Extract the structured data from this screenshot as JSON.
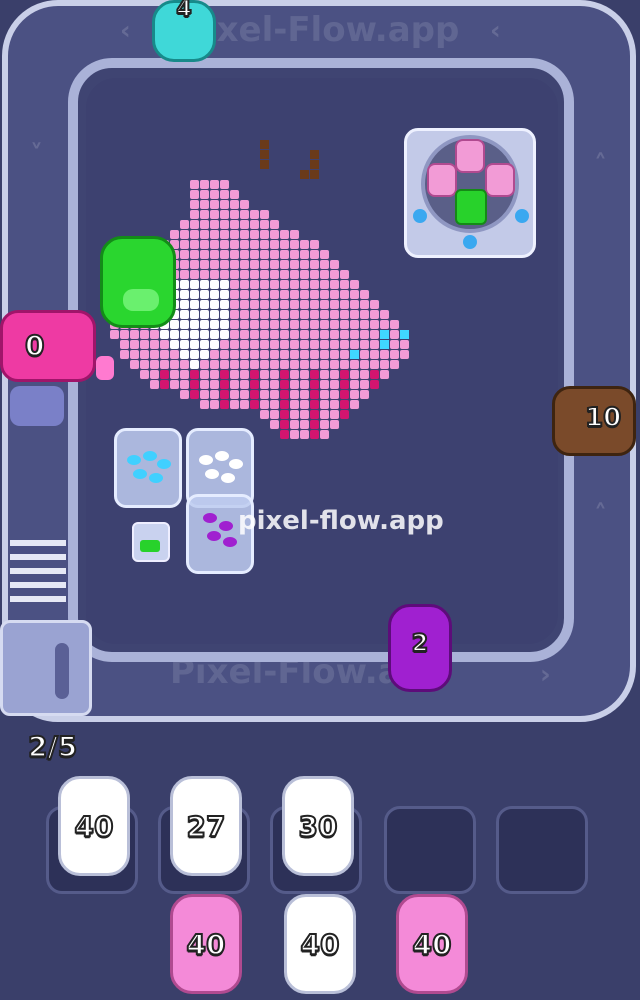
{
  "track": {
    "label": "Pixel-Flow.app",
    "accent_color": "#aab2d8"
  },
  "watermark": "pixel-flow.app",
  "capacity": {
    "label": "2/5",
    "current": 2,
    "max": 5
  },
  "conveyor_shooters": [
    {
      "count": "4",
      "color": "#3fd8d8"
    },
    {
      "count": "0",
      "color": "#ee3aa3"
    },
    {
      "count": "10",
      "color": "#7a4a2a"
    },
    {
      "count": "2",
      "color": "#a020d0"
    }
  ],
  "pixel_art": {
    "subject": "pink pig",
    "colors": [
      "#f29bd6",
      "#ffffff",
      "#d2156f",
      "#6a3a1a",
      "#40d8ff"
    ]
  },
  "bonus_box": {
    "pig_color": "#f29bd6",
    "block_color": "#28d22b"
  },
  "queue_slots": [
    {
      "count": "40",
      "color": "#ffffff"
    },
    {
      "count": "27",
      "color": "#ffffff"
    },
    {
      "count": "30",
      "color": "#ffffff"
    },
    {
      "count": "",
      "color": "empty"
    },
    {
      "count": "",
      "color": "empty"
    }
  ],
  "waiting_pigs": [
    {
      "count": "40",
      "color": "#f48ad8"
    },
    {
      "count": "40",
      "color": "#ffffff"
    },
    {
      "count": "40",
      "color": "#f48ad8"
    }
  ],
  "jars": [
    {
      "color": "#40d0ff"
    },
    {
      "color": "#ffffff"
    },
    {
      "color": "#a020d0"
    }
  ]
}
